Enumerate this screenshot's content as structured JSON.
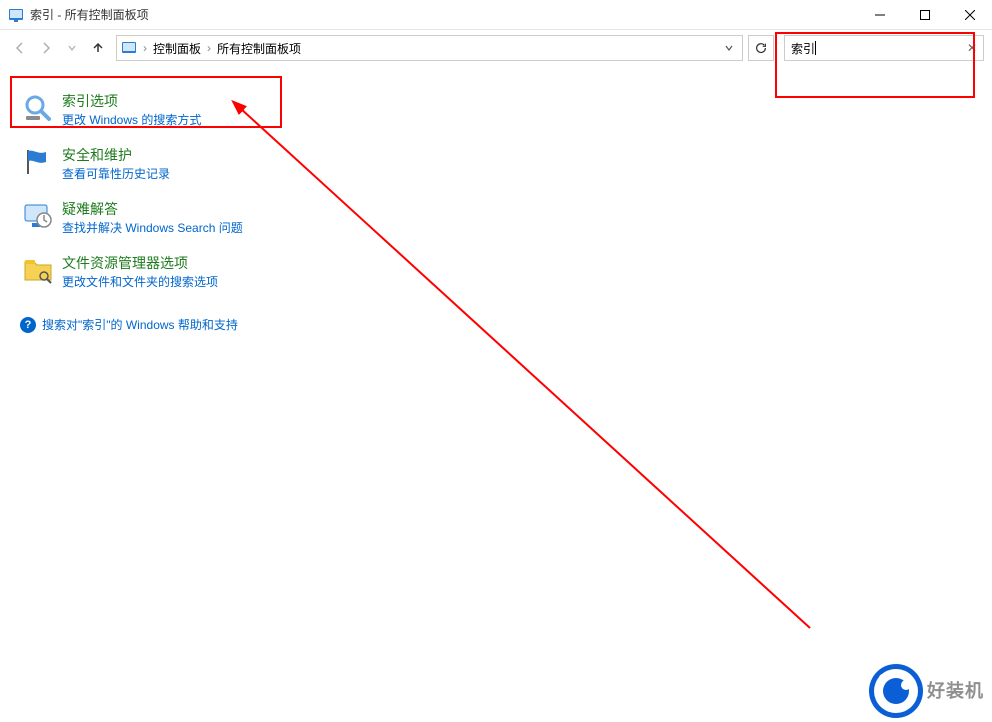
{
  "window": {
    "title": "索引 - 所有控制面板项"
  },
  "nav": {
    "crumbs": [
      "控制面板",
      "所有控制面板项"
    ],
    "search_value": "索引"
  },
  "results": [
    {
      "title": "索引选项",
      "subtitle": "更改 Windows 的搜索方式",
      "icon": "search-index"
    },
    {
      "title": "安全和维护",
      "subtitle": "查看可靠性历史记录",
      "icon": "flag"
    },
    {
      "title": "疑难解答",
      "subtitle": "查找并解决 Windows Search 问题",
      "icon": "troubleshoot"
    },
    {
      "title": "文件资源管理器选项",
      "subtitle": "更改文件和文件夹的搜索选项",
      "icon": "folder-options"
    }
  ],
  "help": {
    "text": "搜索对\"索引\"的 Windows 帮助和支持"
  },
  "watermark": {
    "line1": "好装机"
  }
}
